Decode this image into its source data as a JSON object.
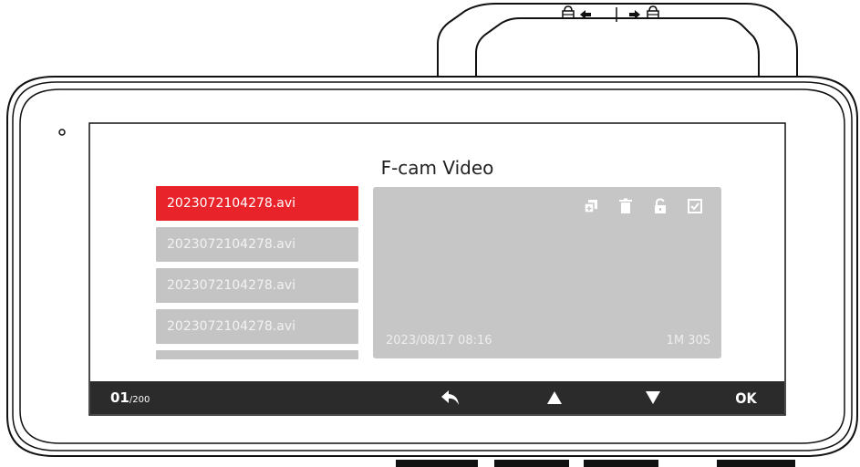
{
  "screen": {
    "title": "F-cam Video"
  },
  "file_list": {
    "items": [
      {
        "name": "2023072104278.avi",
        "selected": true
      },
      {
        "name": "2023072104278.avi",
        "selected": false
      },
      {
        "name": "2023072104278.avi",
        "selected": false
      },
      {
        "name": "2023072104278.avi",
        "selected": false
      }
    ]
  },
  "preview": {
    "date": "2023/08/17 08:16",
    "duration": "1M 30S",
    "icons": [
      "copy-icon",
      "trash-icon",
      "unlock-icon",
      "checkbox-icon"
    ]
  },
  "bottom_bar": {
    "page_current": "01",
    "page_total": "/200",
    "ok_label": "OK",
    "buttons": [
      "back-arrow-icon",
      "up-triangle-icon",
      "down-triangle-icon"
    ]
  },
  "device": {
    "mount_left_icon": "lock-arrow-left-icon",
    "mount_right_icon": "arrow-right-lock-icon"
  },
  "colors": {
    "accent": "#e8232a",
    "list_item_bg": "#c4c4c4",
    "preview_bg": "#c6c6c6",
    "bottom_bar_bg": "#2b2b2b"
  }
}
